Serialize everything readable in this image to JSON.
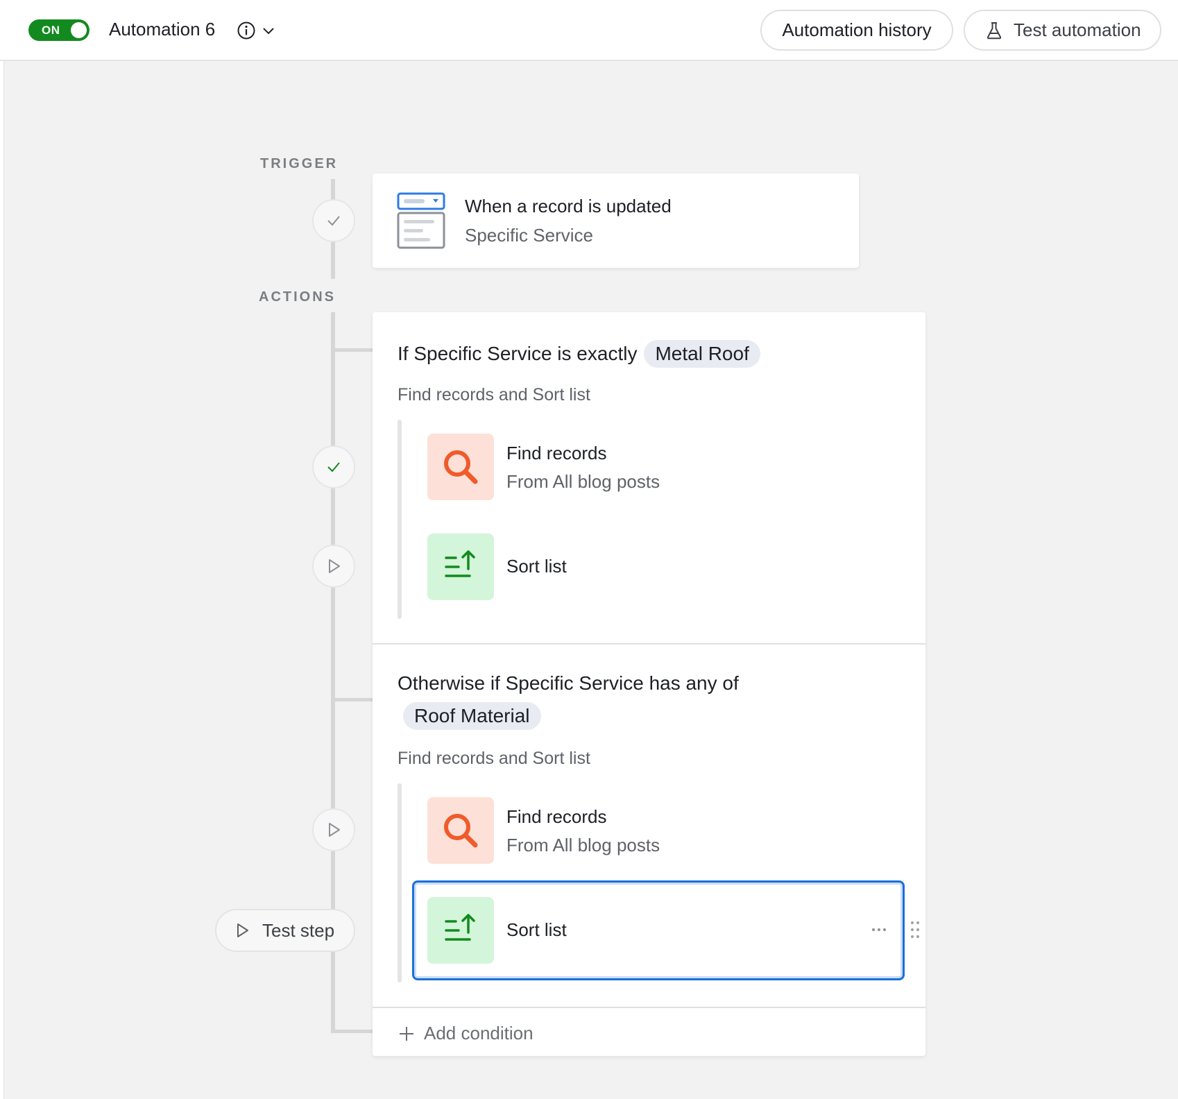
{
  "header": {
    "toggle_label": "ON",
    "automation_name": "Automation 6",
    "history_button": "Automation history",
    "test_button": "Test automation"
  },
  "rail": {
    "trigger_label": "TRIGGER",
    "actions_label": "ACTIONS",
    "test_step_label": "Test step"
  },
  "trigger": {
    "title": "When a record is updated",
    "subtitle": "Specific Service"
  },
  "conditions": [
    {
      "prefix": "If Specific Service is exactly",
      "value": "Metal Roof",
      "summary": "Find records and Sort list",
      "steps": [
        {
          "title": "Find records",
          "subtitle": "From All blog posts"
        },
        {
          "title": "Sort list"
        }
      ]
    },
    {
      "prefix": "Otherwise if Specific Service has any of",
      "value": "Roof Material",
      "summary": "Find records and Sort list",
      "steps": [
        {
          "title": "Find records",
          "subtitle": "From All blog posts"
        },
        {
          "title": "Sort list"
        }
      ]
    }
  ],
  "add_condition": "Add condition",
  "colors": {
    "toggle_on": "#128a1f",
    "find_icon": "#ef5b2b",
    "find_bg": "#fde0d7",
    "sort_icon": "#128a1f",
    "sort_bg": "#d3f5d9",
    "selection": "#1b6fd8"
  }
}
